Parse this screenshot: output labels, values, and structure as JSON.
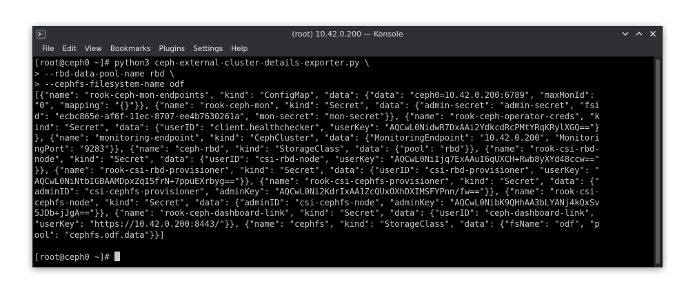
{
  "window": {
    "title": "(root) 10.42.0.200 — Konsole"
  },
  "menu": {
    "items": [
      "File",
      "Edit",
      "View",
      "Bookmarks",
      "Plugins",
      "Settings",
      "Help"
    ]
  },
  "terminal": {
    "lines": [
      "[root@ceph0 ~]# python3 ceph-external-cluster-details-exporter.py \\",
      "> --rbd-data-pool-name rbd \\",
      "> --cephfs-filesystem-name odf",
      "[{\"name\": \"rook-ceph-mon-endpoints\", \"kind\": \"ConfigMap\", \"data\": {\"data\": \"ceph0=10.42.0.200:6789\", \"maxMonId\":",
      "\"0\", \"mapping\": \"{}\"}}, {\"name\": \"rook-ceph-mon\", \"kind\": \"Secret\", \"data\": {\"admin-secret\": \"admin-secret\", \"fsi",
      "d\": \"ecbc865e-af6f-11ec-8707-ee4b7630261a\", \"mon-secret\": \"mon-secret\"}}, {\"name\": \"rook-ceph-operator-creds\", \"k",
      "ind\": \"Secret\", \"data\": {\"userID\": \"client.healthchecker\", \"userKey\": \"AQCwL0NidwR7DxAAi2YdkcdRcPMtYRqKRylXGQ==\"}",
      "}, {\"name\": \"monitoring-endpoint\", \"kind\": \"CephCluster\", \"data\": {\"MonitoringEndpoint\": \"10.42.0.200\", \"Monitori",
      "ngPort\": \"9283\"}}, {\"name\": \"ceph-rbd\", \"kind\": \"StorageClass\", \"data\": {\"pool\": \"rbd\"}}, {\"name\": \"rook-csi-rbd-",
      "node\", \"kind\": \"Secret\", \"data\": {\"userID\": \"csi-rbd-node\", \"userKey\": \"AQCwL0NiIjq7ExAAuI6qUXCH+Rwb8yXYd48ccw==\"",
      "}}, {\"name\": \"rook-csi-rbd-provisioner\", \"kind\": \"Secret\", \"data\": {\"userID\": \"csi-rbd-provisioner\", \"userKey\": \"",
      "AQCwL0NiNtbIGBAAMDpxZqI5frN+7ppuEXrbyg==\"}}, {\"name\": \"rook-csi-cephfs-provisioner\", \"kind\": \"Secret\", \"data\": {\"",
      "adminID\": \"csi-cephfs-provisioner\", \"adminKey\": \"AQCwL0Ni2KdrIxAA1ZcQUxOXhDXIMSFYPnn/fw==\"}}, {\"name\": \"rook-csi-",
      "cephfs-node\", \"kind\": \"Secret\", \"data\": {\"adminID\": \"csi-cephfs-node\", \"adminKey\": \"AQCwL0NibK9QHhAA3bLYANj4kQxSv",
      "5JDb+jJgA==\"}}, {\"name\": \"rook-ceph-dashboard-link\", \"kind\": \"Secret\", \"data\": {\"userID\": \"ceph-dashboard-link\",",
      "\"userKey\": \"https://10.42.0.200:8443/\"}}, {\"name\": \"cephfs\", \"kind\": \"StorageClass\", \"data\": {\"fsName\": \"odf\", \"p",
      "ool\": \"cephfs.odf.data\"}}]",
      "",
      "[root@ceph0 ~]# "
    ]
  },
  "icons": {
    "app": "konsole-app-icon",
    "minimize": "chevron-down-icon",
    "maximize": "chevron-up-icon",
    "close": "close-icon"
  },
  "colors": {
    "titlebar": "#2e3034",
    "terminal_bg": "#000000",
    "terminal_fg": "#c8c8c8"
  }
}
